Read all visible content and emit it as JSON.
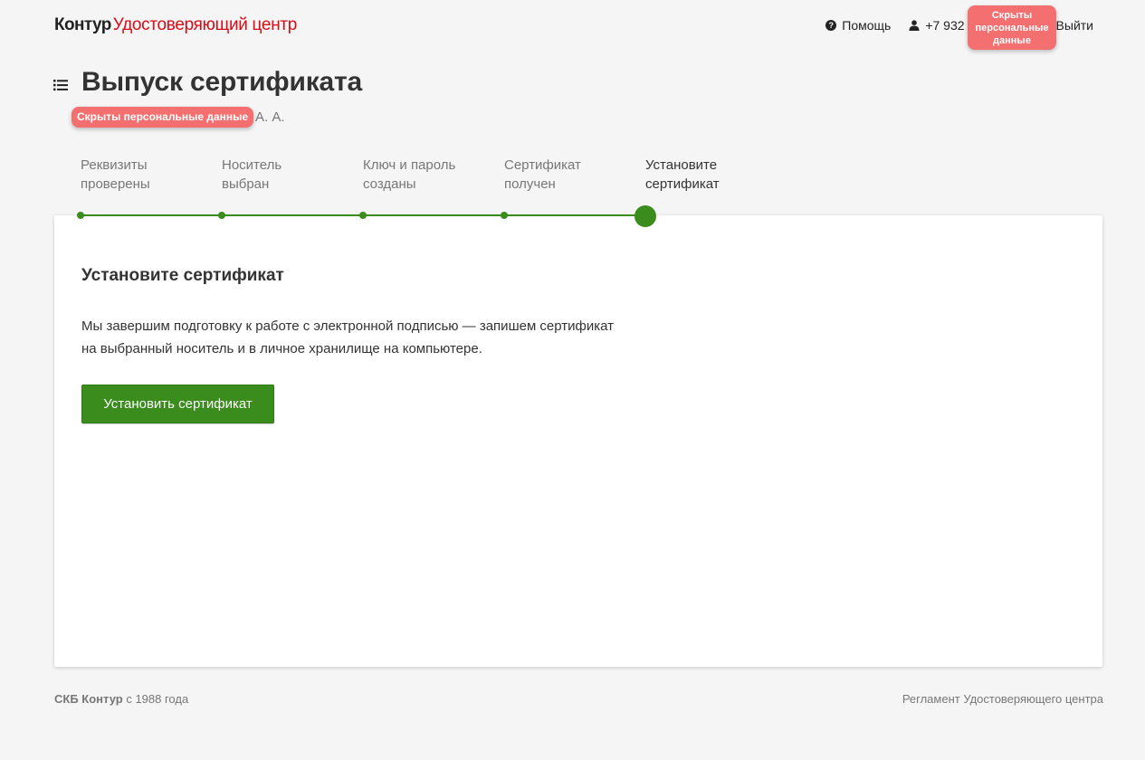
{
  "header": {
    "brand": "Контур",
    "product": "Удостоверяющий центр",
    "help_label": "Помощь",
    "help_icon": "question-circle-icon",
    "user_icon": "user-icon",
    "phone": "+7 932",
    "logout_label": "Выйти",
    "hidden_data_badge": "Скрыты персональные данные"
  },
  "page": {
    "title": "Выпуск сертификата",
    "owner_initials": "А. А.",
    "hidden_name_badge": "Скрыты персональные данные"
  },
  "stepper": {
    "steps": [
      {
        "label": "Реквизиты проверены",
        "state": "done"
      },
      {
        "label": "Носитель выбран",
        "state": "done"
      },
      {
        "label": "Ключ и пароль созданы",
        "state": "done"
      },
      {
        "label": "Сертификат получен",
        "state": "done"
      },
      {
        "label": "Установите сертификат",
        "state": "active"
      }
    ],
    "color": "#3a8c1d"
  },
  "card": {
    "title": "Установите сертификат",
    "text": "Мы завершим подготовку к работе с электронной подписью — запишем сертификат на выбранный носитель и в личное хранилище на компьютере.",
    "button_label": "Установить сертификат"
  },
  "footer": {
    "company": "СКБ Контур",
    "since": "с 1988 года",
    "regulations_link": "Регламент Удостоверяющего центра"
  },
  "colors": {
    "accent": "#3a8c1d",
    "brand_red": "#d70c17",
    "badge": "#f46f6f",
    "background": "#f5f5f5"
  }
}
